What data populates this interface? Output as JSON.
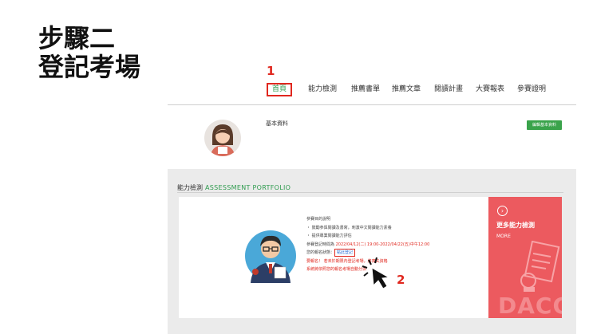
{
  "step": {
    "line1": "步驟二",
    "line2": "登記考場"
  },
  "markers": {
    "first": "1",
    "second": "2"
  },
  "nav": {
    "items": [
      {
        "label": "首頁",
        "active": true
      },
      {
        "label": "能力檢測"
      },
      {
        "label": "推薦書單"
      },
      {
        "label": "推薦文章"
      },
      {
        "label": "閱讀計畫"
      },
      {
        "label": "大賽報表"
      },
      {
        "label": "參賽證明"
      }
    ]
  },
  "profile": {
    "basic_label": "基本資料",
    "edit_button": "編輯基本資料"
  },
  "portfolio": {
    "heading_zh": "能力檢測",
    "heading_en": "ASSESSMENT PORTFOLIO",
    "lines": {
      "purpose": "參賽目的說明",
      "bullet1": "・ 鼓勵參與閱讀及書寫，刺激中文閱讀能力素養",
      "bullet2": "・ 提供專業閱讀能力評估",
      "period_prefix": "參賽登記時間為 ",
      "period_value": "2022/04/12(二) 19:00-2022/04/22(五)中午12:00",
      "status_prefix": "您的報名狀態：",
      "register_link": "點此登記",
      "warn1": "要報名！ 若未於期限內登記考場，將喪失資格",
      "warn2": "系統將依照您的報名考場自動分派"
    }
  },
  "side_card": {
    "title": "更多能力檢測",
    "more": "MORE",
    "stamp": "DACC"
  },
  "colors": {
    "accent_green": "#2e9b4e",
    "marker_red": "#e0281f",
    "card_red": "#ec5a5f"
  }
}
